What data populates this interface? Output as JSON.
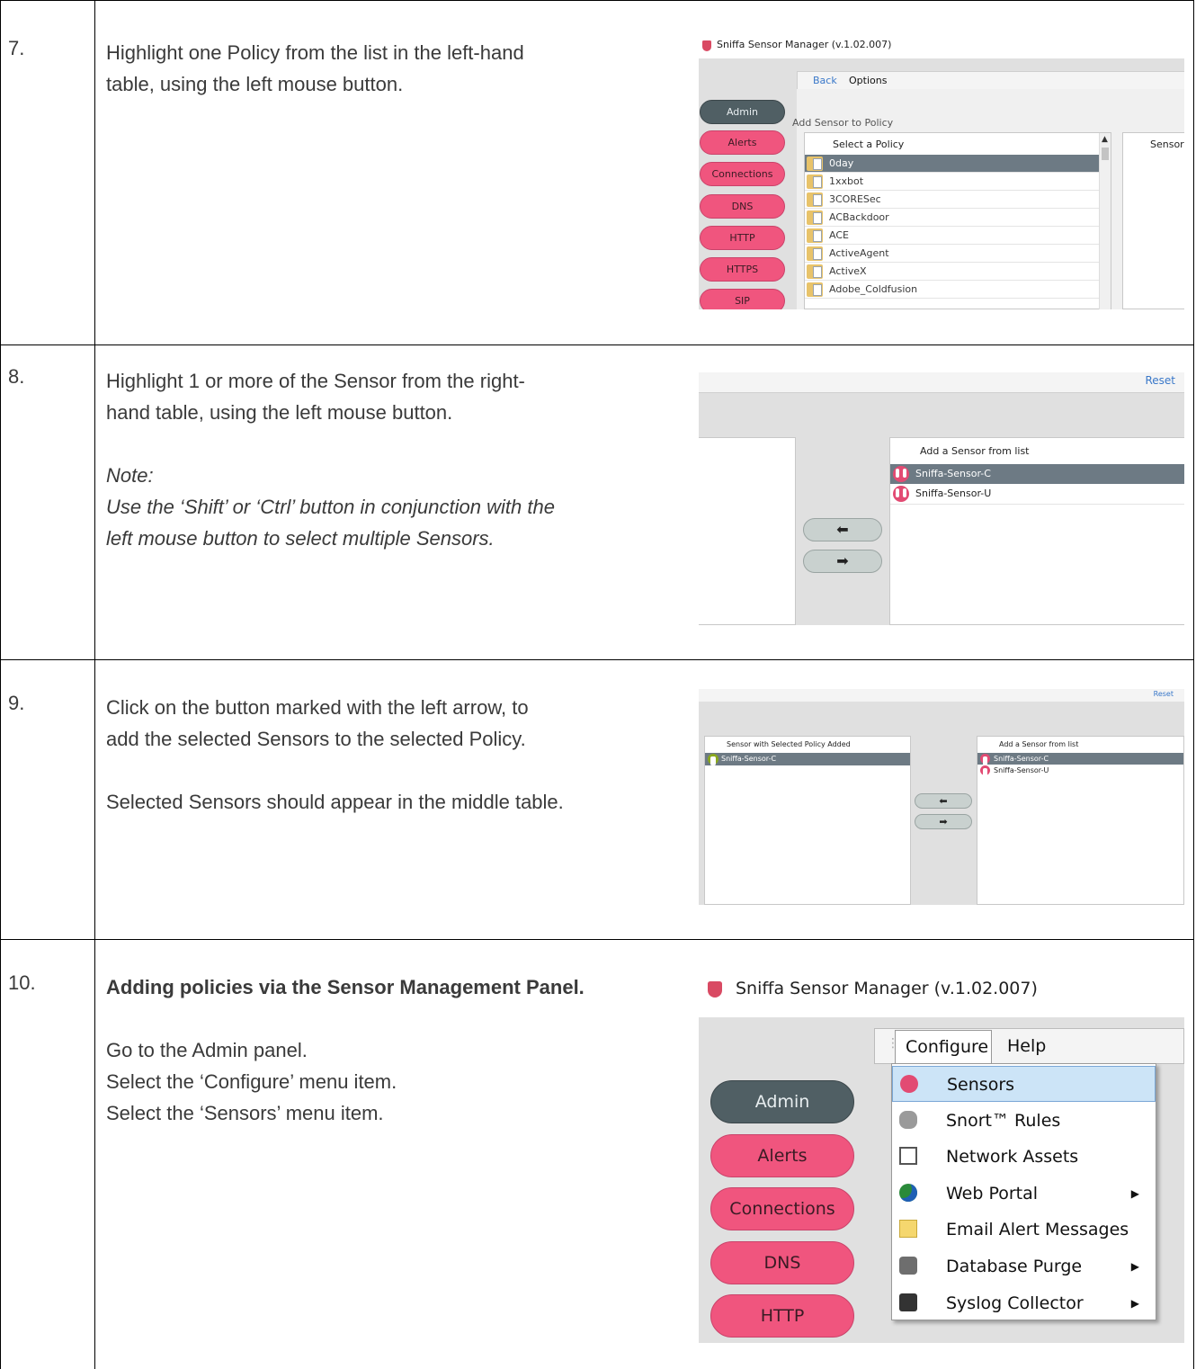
{
  "steps": [
    {
      "number": "7.",
      "lines": [
        "Highlight one Policy from the list in the left-hand",
        "table, using the left mouse button."
      ]
    },
    {
      "number": "8.",
      "lines": [
        "Highlight 1 or more of the Sensor from the right-",
        "hand table, using the left mouse button."
      ],
      "note_label": "Note:",
      "note_lines": [
        "Use the ‘Shift’ or ‘Ctrl’ button in conjunction with the",
        "left mouse button to select multiple Sensors."
      ]
    },
    {
      "number": "9.",
      "lines": [
        "Click on the button marked with the left arrow, to",
        "add the selected Sensors to the selected Policy."
      ],
      "extra": "Selected Sensors should appear in the middle table."
    },
    {
      "number": "10.",
      "heading": "Adding policies via the Sensor Management Panel.",
      "lines": [
        "Go to the Admin panel.",
        "Select the ‘Configure’ menu item.",
        "Select the ‘Sensors’ menu item."
      ]
    }
  ],
  "shot7": {
    "window_title": "Sniffa Sensor Manager (v.1.02.007)",
    "back": "Back",
    "options": "Options",
    "section": "Add Sensor to Policy",
    "col_header": "Select a Policy",
    "right_header": "Sensor v",
    "nav": [
      "Admin",
      "Alerts",
      "Connections",
      "DNS",
      "HTTP",
      "HTTPS",
      "SIP"
    ],
    "policies": [
      "0day",
      "1xxbot",
      "3CORESec",
      "ACBackdoor",
      "ACE",
      "ActiveAgent",
      "ActiveX",
      "Adobe_Coldfusion"
    ],
    "selected_index": 0
  },
  "shot8": {
    "reset": "Reset",
    "header": "Add a Sensor from list",
    "sensors": [
      "Sniffa-Sensor-C",
      "Sniffa-Sensor-U"
    ],
    "selected_index": 0,
    "left_arrow": "⬅",
    "right_arrow": "➡"
  },
  "shot9": {
    "reset": "Reset",
    "left_header": "Sensor with Selected Policy Added",
    "left_rows": [
      "Sniffa-Sensor-C"
    ],
    "right_header": "Add a Sensor from list",
    "sensors": [
      "Sniffa-Sensor-C",
      "Sniffa-Sensor-U"
    ],
    "left_arrow": "⬅",
    "right_arrow": "➡"
  },
  "shot10": {
    "window_title": "Sniffa Sensor Manager (v.1.02.007)",
    "menu_bar": [
      "Configure",
      "Help"
    ],
    "nav": [
      "Admin",
      "Alerts",
      "Connections",
      "DNS",
      "HTTP"
    ],
    "menu_items": [
      {
        "label": "Sensors",
        "icon": "sensor-icon",
        "submenu": false
      },
      {
        "label": "Snort™ Rules",
        "icon": "pig-icon",
        "submenu": false
      },
      {
        "label": "Network Assets",
        "icon": "network-icon",
        "submenu": false
      },
      {
        "label": "Web Portal",
        "icon": "globe-icon",
        "submenu": true
      },
      {
        "label": "Email Alert Messages",
        "icon": "envelope-icon",
        "submenu": false
      },
      {
        "label": "Database Purge",
        "icon": "database-icon",
        "submenu": true
      },
      {
        "label": "Syslog Collector",
        "icon": "log-icon",
        "submenu": true
      }
    ],
    "submenu_arrow": "▶"
  }
}
